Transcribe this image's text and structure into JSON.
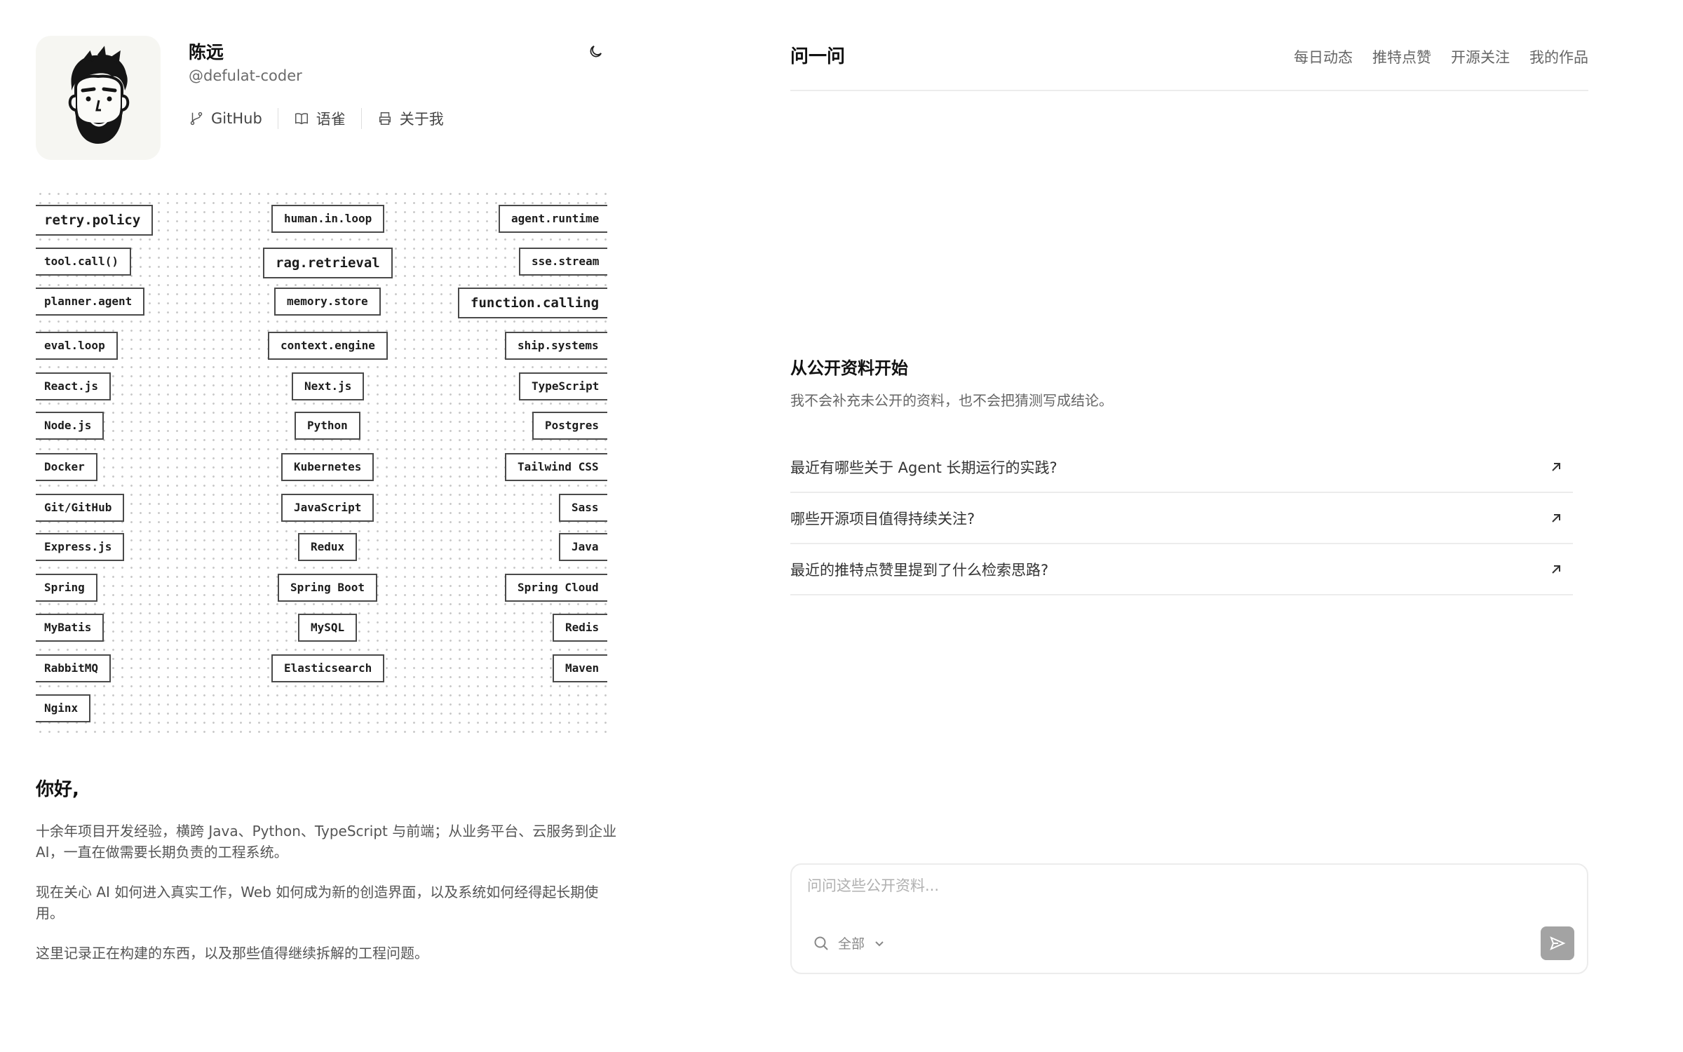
{
  "profile": {
    "name": "陈远",
    "handle": "@defulat-coder",
    "links": [
      {
        "label": "GitHub",
        "icon": "git-branch-icon"
      },
      {
        "label": "语雀",
        "icon": "book-icon"
      },
      {
        "label": "关于我",
        "icon": "printer-icon"
      }
    ],
    "theme_toggle_icon": "moon-icon"
  },
  "tags": {
    "rows": [
      [
        "retry.policy",
        "human.in.loop",
        "agent.runtime"
      ],
      [
        "tool.call()",
        "rag.retrieval",
        "sse.stream"
      ],
      [
        "planner.agent",
        "memory.store",
        "function.calling"
      ],
      [
        "eval.loop",
        "context.engine",
        "ship.systems"
      ],
      [
        "React.js",
        "Next.js",
        "TypeScript"
      ],
      [
        "Node.js",
        "Python",
        "Postgres"
      ],
      [
        "Docker",
        "Kubernetes",
        "Tailwind CSS"
      ],
      [
        "Git/GitHub",
        "JavaScript",
        "Sass"
      ],
      [
        "Express.js",
        "Redux",
        "Java"
      ],
      [
        "Spring",
        "Spring Boot",
        "Spring Cloud"
      ],
      [
        "MyBatis",
        "MySQL",
        "Redis"
      ],
      [
        "RabbitMQ",
        "Elasticsearch",
        "Maven"
      ],
      [
        "Nginx"
      ]
    ]
  },
  "intro": {
    "greeting": "你好,",
    "paragraphs": [
      "十余年项目开发经验，横跨 Java、Python、TypeScript 与前端；从业务平台、云服务到企业 AI，一直在做需要长期负责的工程系统。",
      "现在关心 AI 如何进入真实工作，Web 如何成为新的创造界面，以及系统如何经得起长期使用。",
      "这里记录正在构建的东西，以及那些值得继续拆解的工程问题。"
    ]
  },
  "header": {
    "title": "问一问",
    "nav": [
      "每日动态",
      "推特点赞",
      "开源关注",
      "我的作品"
    ]
  },
  "ask": {
    "section_title": "从公开资料开始",
    "section_subtitle": "我不会补充未公开的资料，也不会把猜测写成结论。",
    "questions": [
      "最近有哪些关于 Agent 长期运行的实践?",
      "哪些开源项目值得持续关注?",
      "最近的推特点赞里提到了什么检索思路?"
    ],
    "input_placeholder": "问问这些公开资料...",
    "scope_label": "全部"
  },
  "colors": {
    "text": "#1a1a1a",
    "muted": "#666666",
    "border": "#ececec",
    "send_button": "#a3a3a3",
    "avatar_bg": "#f6f6f2"
  }
}
